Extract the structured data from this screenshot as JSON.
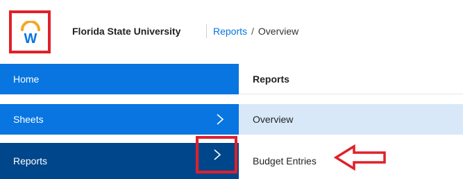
{
  "header": {
    "logo": {
      "icon": "workday-logo-icon",
      "letter": "W"
    },
    "org_name": "Florida State University",
    "breadcrumb": {
      "parent": "Reports",
      "separator": "/",
      "current": "Overview"
    }
  },
  "left_nav": {
    "items": [
      {
        "label": "Home"
      },
      {
        "label": "Sheets",
        "icon": "chevron-right-icon"
      },
      {
        "label": "Reports",
        "icon": "chevron-right-icon"
      }
    ]
  },
  "right_panel": {
    "header": "Reports",
    "items": [
      {
        "label": "Overview"
      },
      {
        "label": "Budget Entries"
      }
    ]
  },
  "colors": {
    "nav_blue": "#0875e1",
    "nav_selected": "#00468a",
    "highlight_red": "#e0202a",
    "logo_orange": "#f5a623",
    "logo_blue": "#0875e1",
    "overview_bg": "#d9e8f8"
  }
}
